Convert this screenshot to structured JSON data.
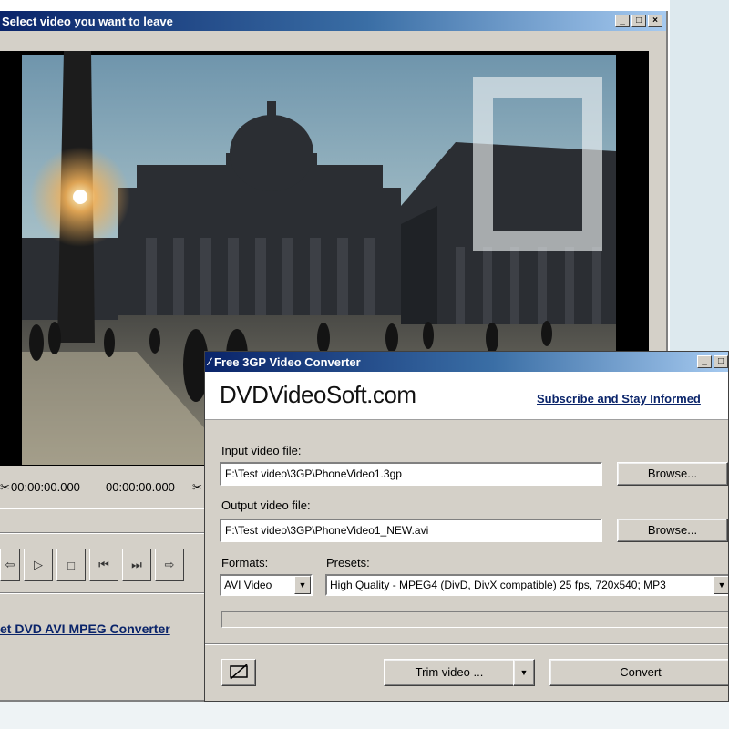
{
  "background_window": {
    "title": "Select video you want to leave",
    "window_controls": [
      "_",
      "□",
      "×"
    ],
    "time_start": "00:00:00.000",
    "time_end": "00:00:00.000",
    "transport_icons": [
      "rewind-icon",
      "play-icon",
      "stop-icon",
      "prev-frame-icon",
      "next-frame-icon",
      "forward-icon"
    ],
    "link": "et DVD AVI MPEG Converter"
  },
  "converter_window": {
    "title": "Free 3GP Video Converter",
    "window_controls": [
      "_",
      "□"
    ],
    "brand": "DVDVideoSoft.com",
    "subscribe_link": "Subscribe and Stay Informed",
    "input_label": "Input video file:",
    "input_value": "F:\\Test video\\3GP\\PhoneVideo1.3gp",
    "input_browse": "Browse...",
    "output_label": "Output video file:",
    "output_value": "F:\\Test video\\3GP\\PhoneVideo1_NEW.avi",
    "output_browse": "Browse...",
    "formats_label": "Formats:",
    "format_value": "AVI Video",
    "presets_label": "Presets:",
    "preset_value": "High Quality - MPEG4 (DivD, DivX compatible) 25 fps, 720x540; MP3",
    "progress": 0,
    "trim_label": "Trim video ...",
    "convert_label": "Convert",
    "icon_button": "screen-off-icon"
  },
  "colors": {
    "titlebar_start": "#0a246a",
    "titlebar_end": "#a6caf0",
    "link": "#0a246a",
    "window_face": "#d4d0c8"
  }
}
